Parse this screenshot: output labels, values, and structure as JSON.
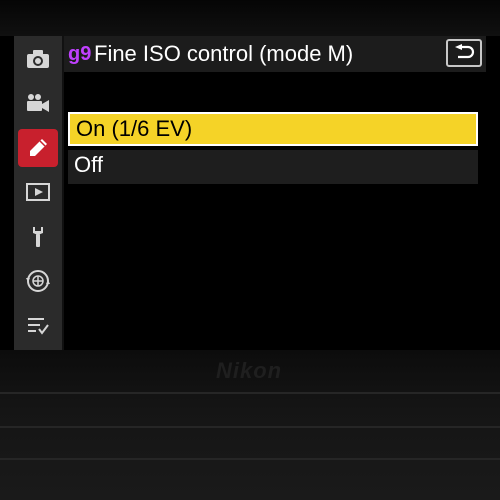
{
  "header": {
    "menu_code": "g9",
    "title": "Fine ISO control (mode M)"
  },
  "sidebar": {
    "items": [
      {
        "icon": "camera-icon",
        "active": false
      },
      {
        "icon": "movie-camera-icon",
        "active": false
      },
      {
        "icon": "pencil-icon",
        "active": true
      },
      {
        "icon": "playback-icon",
        "active": false
      },
      {
        "icon": "wrench-icon",
        "active": false
      },
      {
        "icon": "network-icon",
        "active": false
      },
      {
        "icon": "my-menu-icon",
        "active": false
      }
    ]
  },
  "options": [
    {
      "label": "On (1/6 EV)",
      "selected": true
    },
    {
      "label": "Off",
      "selected": false
    }
  ],
  "brand": "Nikon",
  "colors": {
    "selected_bg": "#f5d327",
    "active_tab": "#c8202d",
    "menu_code": "#c040ff"
  }
}
